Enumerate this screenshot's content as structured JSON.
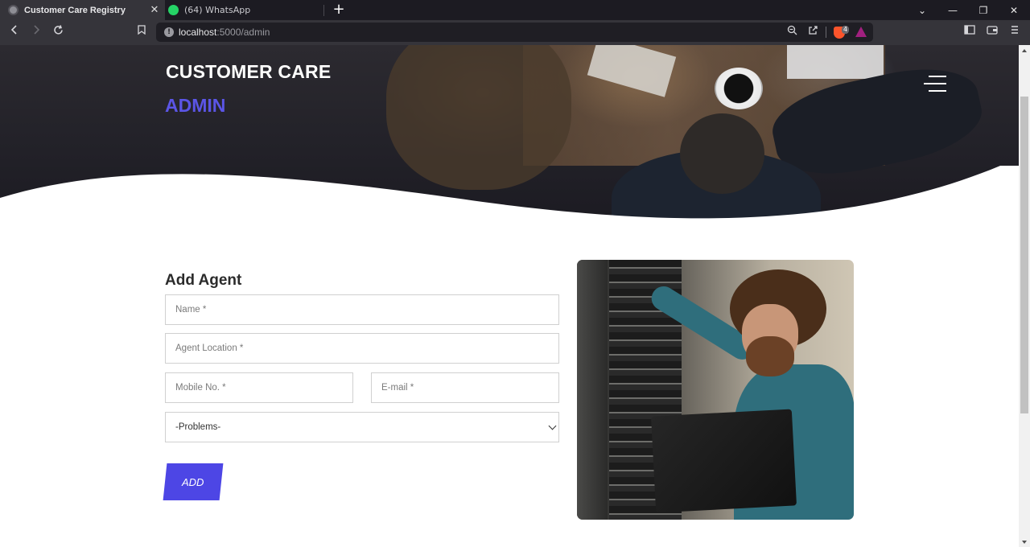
{
  "browser": {
    "tabs": [
      {
        "title": "Customer Care Registry",
        "active": true,
        "icon": "globe-icon"
      },
      {
        "title": "(64) WhatsApp",
        "active": false,
        "icon": "whatsapp-icon"
      }
    ],
    "close_glyph": "✕",
    "new_tab_glyph": "+",
    "url_host": "localhost",
    "url_rest": ":5000/admin",
    "shields_count": "4",
    "window_controls": {
      "tabs_list": "⌄",
      "minimize": "—",
      "maximize": "❐",
      "close": "✕"
    }
  },
  "header": {
    "brand": "CUSTOMER CARE",
    "subtitle": "ADMIN",
    "subtitle_color": "#5b55e6"
  },
  "form": {
    "title": "Add Agent",
    "name_placeholder": "Name *",
    "location_placeholder": "Agent Location *",
    "mobile_placeholder": "Mobile No. *",
    "email_placeholder": "E-mail *",
    "problems_selected": "-Problems-",
    "add_label": "ADD",
    "accent": "#4d46e5"
  }
}
